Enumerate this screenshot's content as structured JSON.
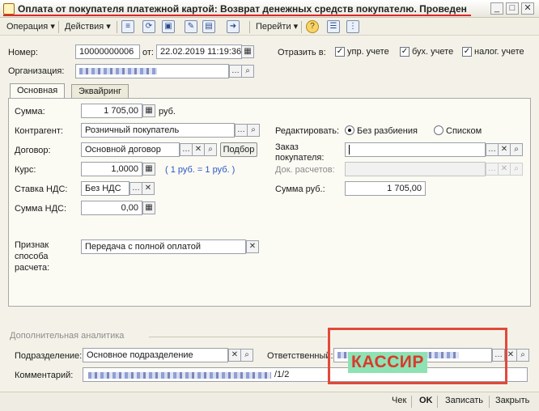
{
  "window": {
    "title": "Оплата от покупателя платежной картой: Возврат денежных средств покупателю. Проведен"
  },
  "toolbar": {
    "operation": "Операция ▾",
    "actions": "Действия ▾",
    "goto": "Перейти ▾"
  },
  "header": {
    "number_label": "Номер:",
    "number_value": "10000000006",
    "date_label": "от:",
    "date_value": "22.02.2019 11:19:36",
    "reflect_label": "Отразить в:",
    "upr_label": "упр. учете",
    "buh_label": "бух. учете",
    "nalog_label": "налог. учете",
    "org_label": "Организация:"
  },
  "tabs": {
    "main": "Основная",
    "acquiring": "Эквайринг"
  },
  "main": {
    "sum_label": "Сумма:",
    "sum_value": "1 705,00",
    "sum_unit": "руб.",
    "contractor_label": "Контрагент:",
    "contractor_value": "Розничный покупатель",
    "contract_label": "Договор:",
    "contract_value": "Основной договор",
    "pick_button": "Подбор",
    "rate_label": "Курс:",
    "rate_value": "1,0000",
    "rate_note": "( 1 руб. = 1 руб. )",
    "vat_rate_label": "Ставка НДС:",
    "vat_rate_value": "Без НДС",
    "vat_sum_label": "Сумма НДС:",
    "vat_sum_value": "0,00",
    "payment_method_label": "Признак\nспособа\nрасчета:",
    "payment_method_value": "Передача с полной оплатой",
    "edit_label": "Редактировать:",
    "no_split_label": "Без разбиения",
    "list_label": "Списком",
    "order_label": "Заказ\nпокупателя:",
    "settle_doc_label": "Док. расчетов:",
    "sum_rub_label": "Сумма руб.:",
    "sum_rub_value": "1 705,00"
  },
  "extra": {
    "section_title": "Дополнительная аналитика",
    "division_label": "Подразделение:",
    "division_value": "Основное подразделение",
    "responsible_label": "Ответственный:",
    "comment_label": "Комментарий:",
    "comment_tail": "/1/2",
    "cashier_annotation": "КАССИР"
  },
  "bottom": {
    "check": "Чек",
    "ok": "OK",
    "save": "Записать",
    "close": "Закрыть"
  },
  "colors": {
    "title_underline": "#e0262a",
    "annotation_box": "#e04a3a",
    "annotation_bg": "#8ee2b4",
    "link_blue": "#2a57c8"
  }
}
